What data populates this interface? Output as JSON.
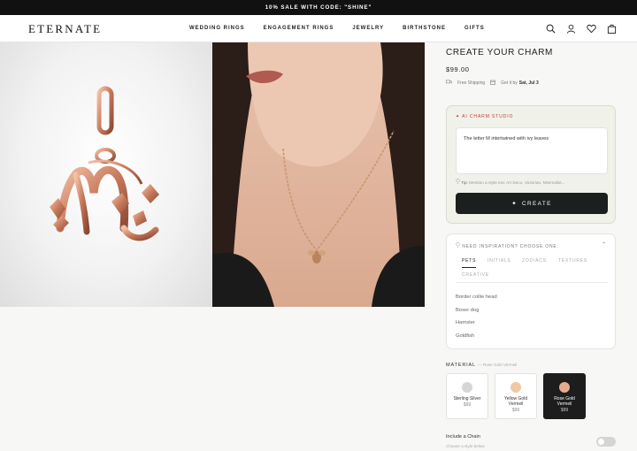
{
  "promo": "10% SALE WITH CODE: \"SHINE\"",
  "header": {
    "logo": "ETERNATE",
    "nav": [
      "WEDDING RINGS",
      "ENGAGEMENT RINGS",
      "JEWELRY",
      "BIRTHSTONE",
      "GIFTS"
    ],
    "icons": [
      "search-icon",
      "account-icon",
      "heart-icon",
      "bag-icon"
    ]
  },
  "product": {
    "title": "CREATE YOUR CHARM",
    "price": "$99.00",
    "shipping": "Free Shipping",
    "delivery_prefix": "Get it by",
    "delivery_date": "Sat, Jul 3"
  },
  "studio": {
    "label": "AI CHARM STUDIO",
    "prompt": "The letter M intertwined with ivy leaves",
    "tip_label": "Tip:",
    "tip_text": "Mention a style era: Art Deco, Victorian, Minimalist...",
    "button": "CREATE"
  },
  "inspiration": {
    "title": "NEED INSPIRATION? CHOOSE ONE.",
    "tabs": [
      "PETS",
      "INITIALS",
      "ZODIACS",
      "TEXTURES",
      "CREATIVE"
    ],
    "active_tab": "PETS",
    "items": [
      "Border collie head",
      "Boxer dog",
      "Hamster",
      "Goldfish"
    ]
  },
  "material": {
    "label": "MATERIAL",
    "selected": "Rose Gold Vermeil",
    "options": [
      {
        "name": "Sterling Silver",
        "price": "$99",
        "color": "#d6d6d6"
      },
      {
        "name": "Yellow Gold Vermeil",
        "price": "$99",
        "color": "#f0c8a4"
      },
      {
        "name": "Rose Gold Vermeil",
        "price": "$99",
        "color": "#e5ab90"
      }
    ]
  },
  "chain": {
    "label": "Include a Chain",
    "sub": "Choose a style below"
  },
  "colors": {
    "accent": "#c0392b",
    "button": "#1b1f1d",
    "promo_bg": "#111111",
    "rose_gold": "#c98468"
  }
}
